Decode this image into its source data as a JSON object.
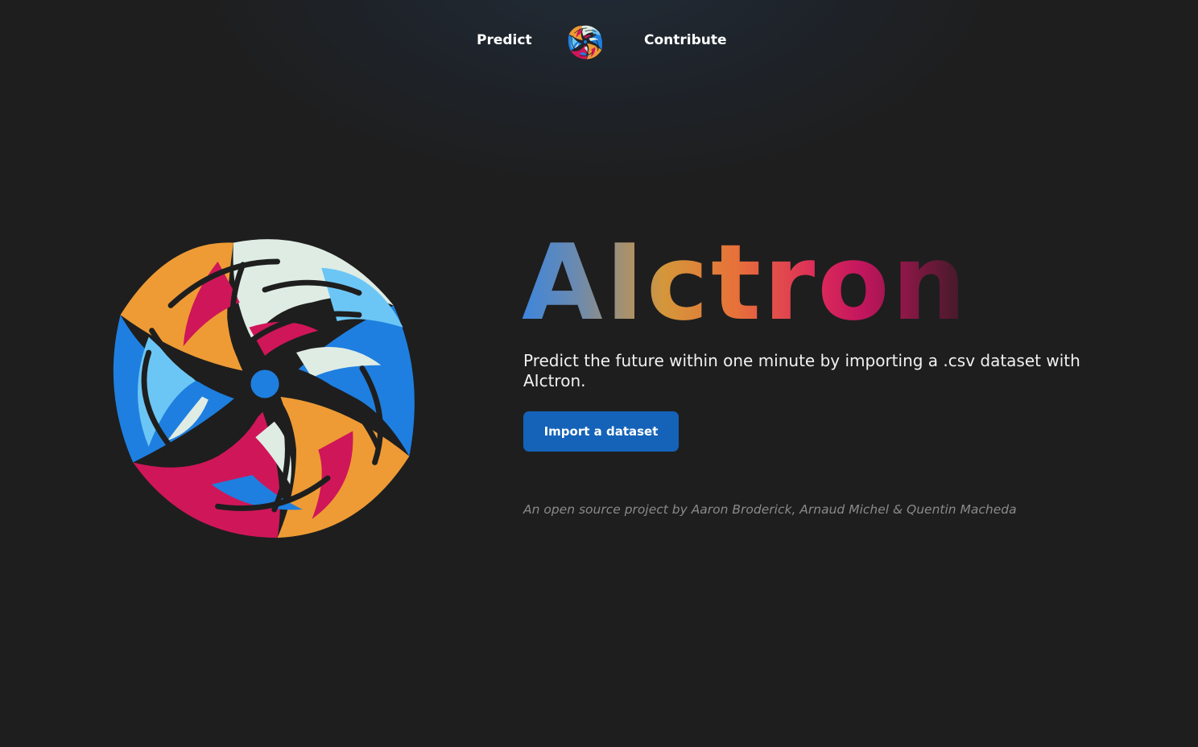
{
  "nav": {
    "predict_label": "Predict",
    "contribute_label": "Contribute",
    "logo_icon": "swirl-logo-icon"
  },
  "hero": {
    "logo_icon": "swirl-logo-icon",
    "title": "AIctron",
    "tagline": "Predict the future within one minute by importing a .csv dataset with AIctron.",
    "cta_label": "Import a dataset",
    "credits": "An open source project by Aaron Broderick, Arnaud Michel & Quentin Macheda"
  },
  "colors": {
    "background": "#1e1e1e",
    "button": "#1463b8",
    "logo_blue": "#1e7fe0",
    "logo_light_blue": "#6cc6f5",
    "logo_orange": "#ee9b35",
    "logo_magenta": "#cf1659",
    "logo_cream": "#dfece4"
  }
}
